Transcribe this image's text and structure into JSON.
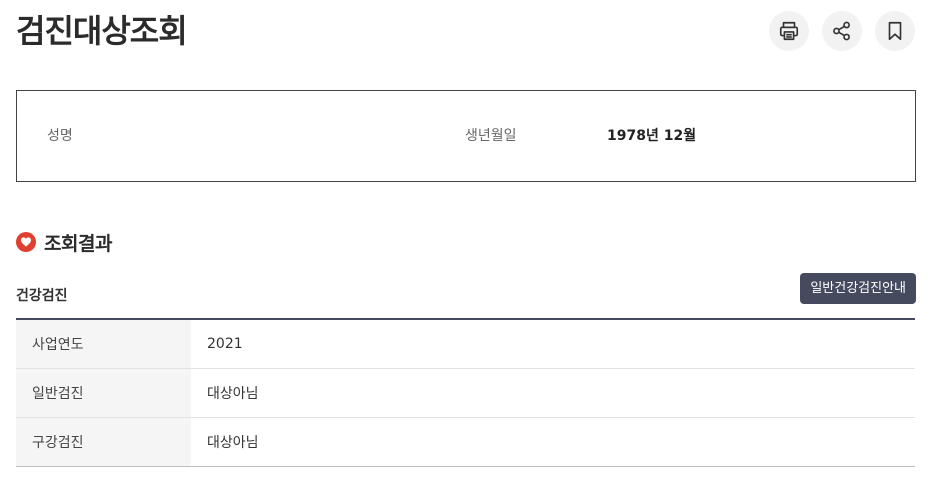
{
  "page": {
    "title": "검진대상조회"
  },
  "actions": {
    "print_icon": "printer-icon",
    "share_icon": "share-icon",
    "bookmark_icon": "bookmark-icon"
  },
  "info": {
    "name_label": "성명",
    "name_value": "",
    "birth_label": "생년월일",
    "birth_value": "1978년 12월"
  },
  "results": {
    "section_title": "조회결과",
    "section_icon": "heart-icon",
    "accent_color": "#e0402f",
    "subtitle": "건강검진",
    "guide_button_label": "일반건강검진안내",
    "rows": [
      {
        "label": "사업연도",
        "value": "2021"
      },
      {
        "label": "일반검진",
        "value": "대상아님"
      },
      {
        "label": "구강검진",
        "value": "대상아님"
      }
    ]
  }
}
